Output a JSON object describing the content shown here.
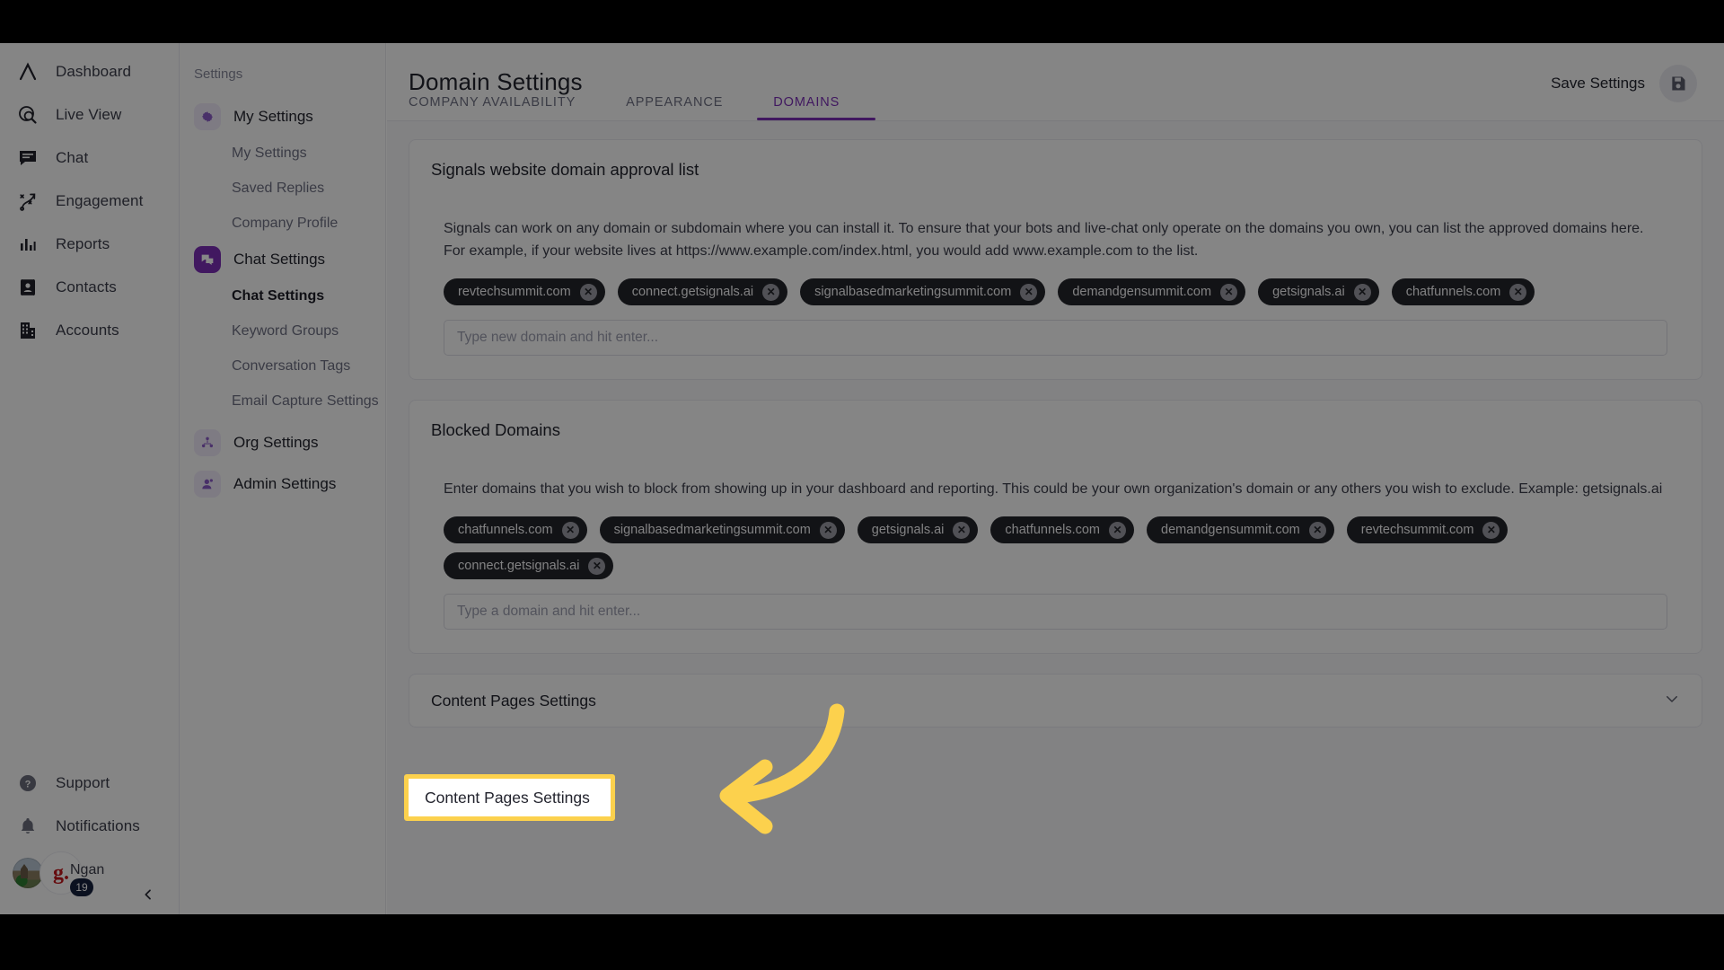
{
  "primary_nav": {
    "items": [
      {
        "label": "Dashboard",
        "icon": "logo-caret-icon"
      },
      {
        "label": "Live View",
        "icon": "live-view-icon"
      },
      {
        "label": "Chat",
        "icon": "chat-bubble-icon"
      },
      {
        "label": "Engagement",
        "icon": "engagement-icon"
      },
      {
        "label": "Reports",
        "icon": "bar-chart-icon"
      },
      {
        "label": "Contacts",
        "icon": "contacts-card-icon"
      },
      {
        "label": "Accounts",
        "icon": "building-icon"
      }
    ],
    "bottom_items": [
      {
        "label": "Support",
        "icon": "question-circle-icon"
      },
      {
        "label": "Notifications",
        "icon": "bell-icon"
      }
    ],
    "user": {
      "name": "Ngan",
      "badge_count": "19",
      "brand_mark": "g.",
      "avatar": "user-avatar"
    },
    "collapse_icon": "chevron-left-icon"
  },
  "settings_nav": {
    "section_title": "Settings",
    "groups": [
      {
        "label": "My Settings",
        "icon": "gear-icon",
        "active": false,
        "items": [
          {
            "label": "My Settings",
            "current": false
          },
          {
            "label": "Saved Replies",
            "current": false
          },
          {
            "label": "Company Profile",
            "current": false
          }
        ]
      },
      {
        "label": "Chat Settings",
        "icon": "chat-settings-icon",
        "active": true,
        "items": [
          {
            "label": "Chat Settings",
            "current": true
          },
          {
            "label": "Keyword Groups",
            "current": false
          },
          {
            "label": "Conversation Tags",
            "current": false
          },
          {
            "label": "Email Capture Settings",
            "current": false
          }
        ]
      },
      {
        "label": "Org Settings",
        "icon": "org-users-icon",
        "active": false,
        "items": []
      },
      {
        "label": "Admin Settings",
        "icon": "admin-user-icon",
        "active": false,
        "items": []
      }
    ]
  },
  "header": {
    "title": "Domain Settings",
    "tabs": [
      {
        "label": "COMPANY AVAILABILITY",
        "active": false
      },
      {
        "label": "APPEARANCE",
        "active": false
      },
      {
        "label": "DOMAINS",
        "active": true
      }
    ],
    "save_label": "Save Settings",
    "save_icon": "floppy-disk-save-icon",
    "accent_color": "#7b2fb5"
  },
  "approval_card": {
    "title": "Signals website domain approval list",
    "description": "Signals can work on any domain or subdomain where you can install it. To ensure that your bots and live-chat only operate on the domains you own, you can list the approved domains here. For example, if your website lives at https://www.example.com/index.html, you would add www.example.com to the list.",
    "chips": [
      "revtechsummit.com",
      "connect.getsignals.ai",
      "signalbasedmarketingsummit.com",
      "demandgensummit.com",
      "getsignals.ai",
      "chatfunnels.com"
    ],
    "input_placeholder": "Type new domain and hit enter...",
    "input_value": ""
  },
  "blocked_card": {
    "title": "Blocked Domains",
    "description": "Enter domains that you wish to block from showing up in your dashboard and reporting. This could be your own organization's domain or any others you wish to exclude. Example: getsignals.ai",
    "chips": [
      "chatfunnels.com",
      "signalbasedmarketingsummit.com",
      "getsignals.ai",
      "chatfunnels.com",
      "demandgensummit.com",
      "revtechsummit.com",
      "connect.getsignals.ai"
    ],
    "input_placeholder": "Type a domain and hit enter...",
    "input_value": ""
  },
  "content_pages_row": {
    "label": "Content Pages Settings",
    "chevron_icon": "chevron-down-icon"
  },
  "annotation": {
    "highlight_label": "Content Pages Settings",
    "highlight_color": "#fcd14d",
    "arrow_color": "#fcd14d",
    "arrow_icon": "curved-left-arrow"
  }
}
